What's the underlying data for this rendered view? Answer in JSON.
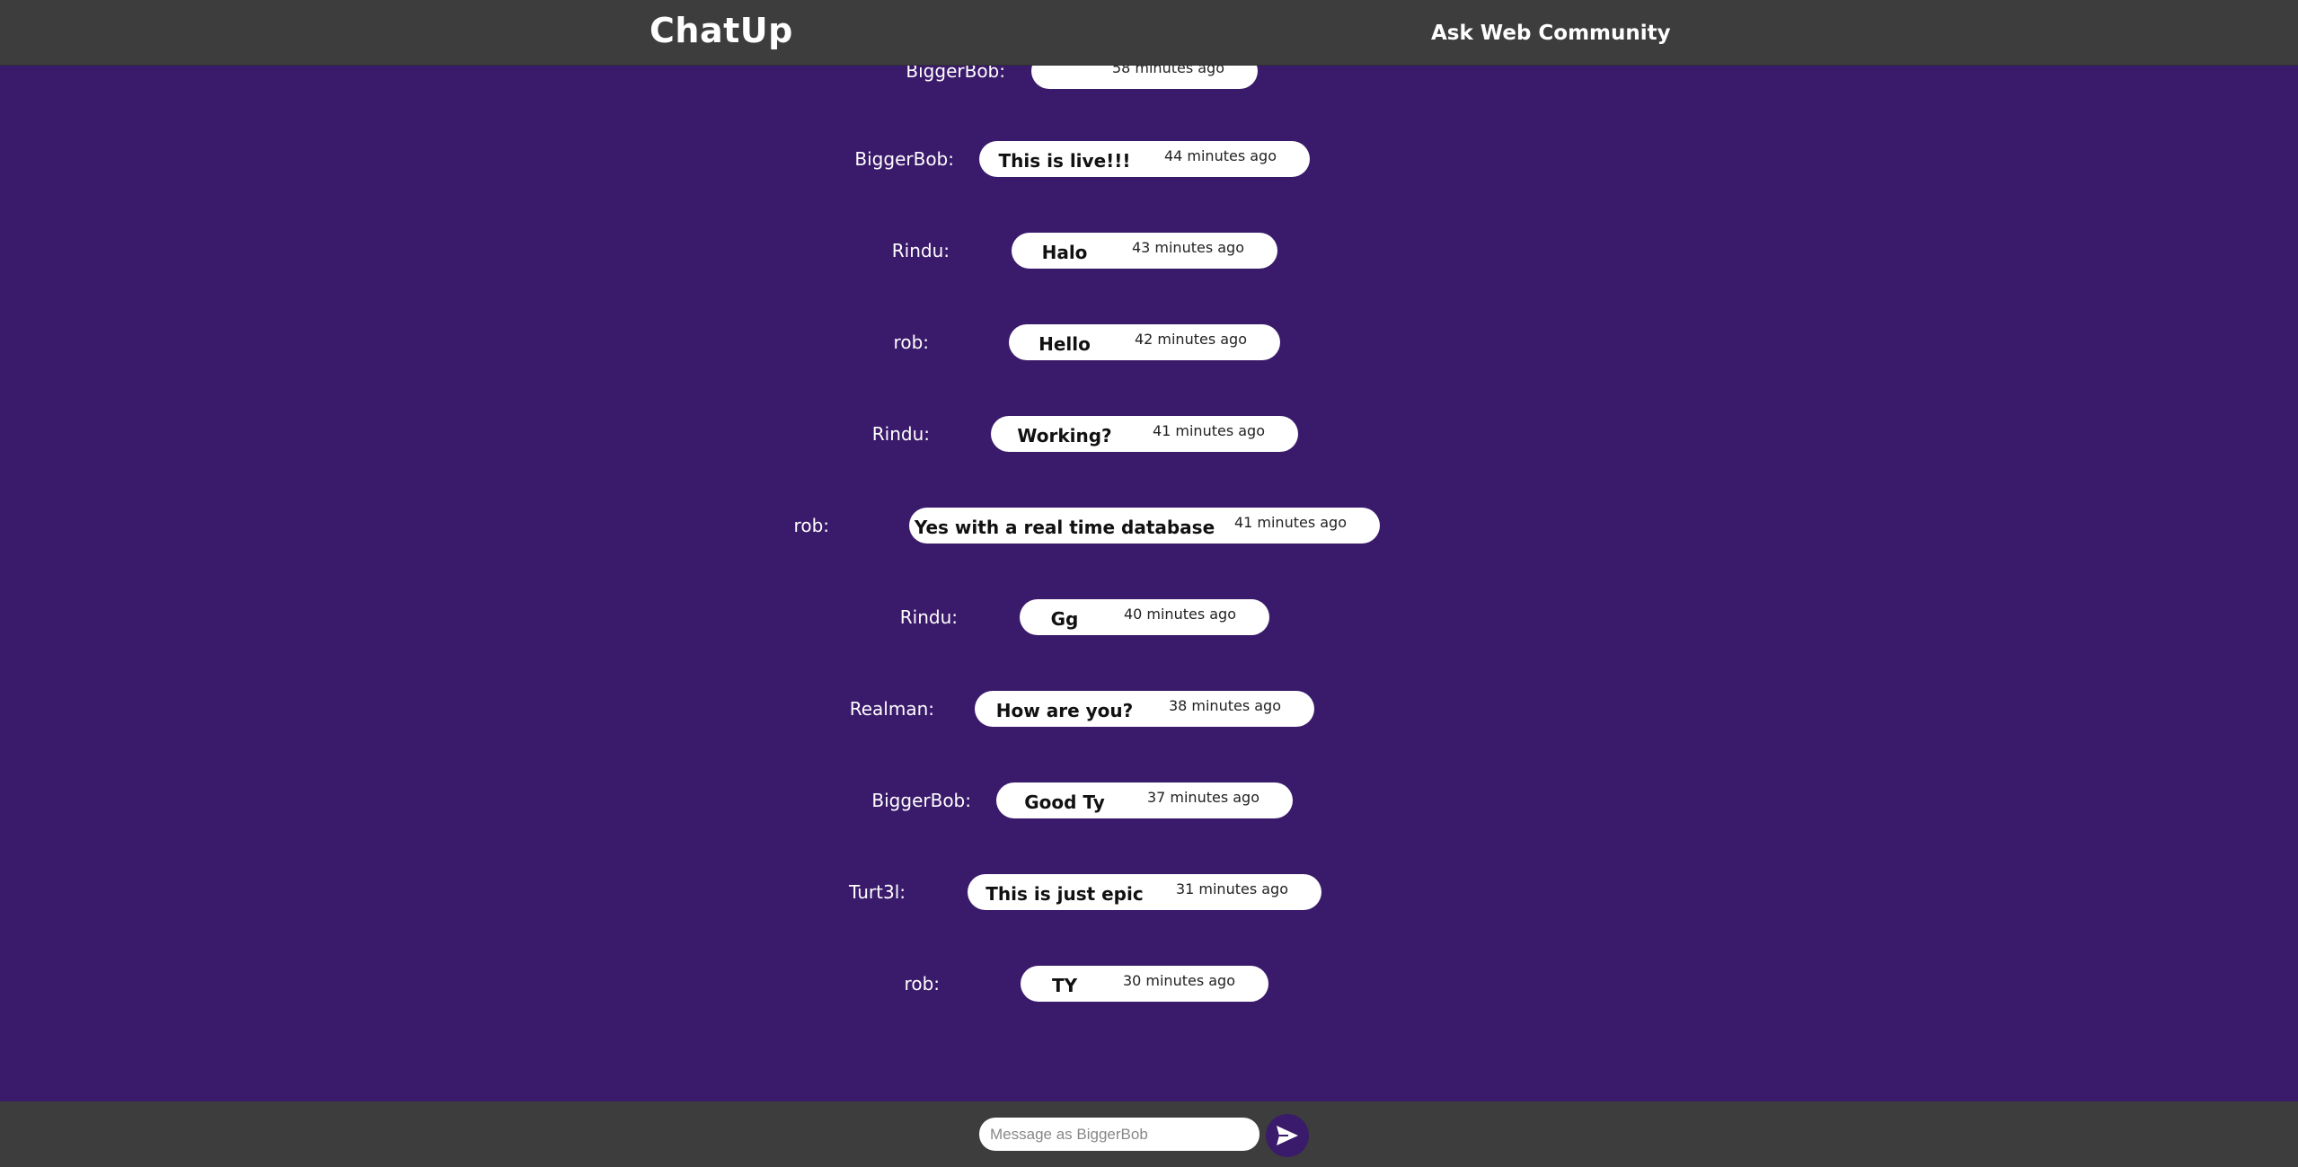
{
  "header": {
    "brand": "ChatUp",
    "community_link": "Ask Web Community"
  },
  "messages": [
    {
      "sender": "BiggerBob:",
      "text": "",
      "time": "58 minutes ago"
    },
    {
      "sender": "BiggerBob:",
      "text": "This is live!!!",
      "time": "44 minutes ago"
    },
    {
      "sender": "Rindu:",
      "text": "Halo",
      "time": "43 minutes ago"
    },
    {
      "sender": "rob:",
      "text": "Hello",
      "time": "42 minutes ago"
    },
    {
      "sender": "Rindu:",
      "text": "Working?",
      "time": "41 minutes ago"
    },
    {
      "sender": "rob:",
      "text": "Yes with a real time database",
      "time": "41 minutes ago"
    },
    {
      "sender": "Rindu:",
      "text": "Gg",
      "time": "40 minutes ago"
    },
    {
      "sender": "Realman:",
      "text": "How are you?",
      "time": "38 minutes ago"
    },
    {
      "sender": "BiggerBob:",
      "text": "Good Ty",
      "time": "37 minutes ago"
    },
    {
      "sender": "Turt3l:",
      "text": "This is just epic",
      "time": "31 minutes ago"
    },
    {
      "sender": "rob:",
      "text": "TY",
      "time": "30 minutes ago"
    }
  ],
  "composer": {
    "placeholder": "Message as BiggerBob",
    "value": ""
  },
  "icons": {
    "send": "send-arrow-icon"
  },
  "colors": {
    "background": "#3a1a6a",
    "bars": "#3d3d3d",
    "bubble": "#ffffff"
  }
}
